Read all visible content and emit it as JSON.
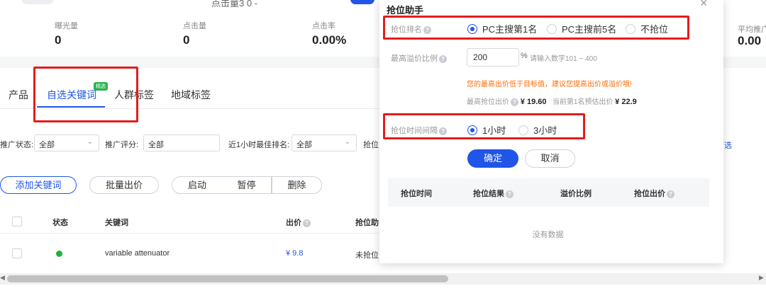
{
  "top": {
    "partial_text": "点击量3 0 -"
  },
  "stats": [
    {
      "label": "曝光量",
      "value": "0"
    },
    {
      "label": "点击量",
      "value": "0"
    },
    {
      "label": "点击率",
      "value": "0.00%"
    }
  ],
  "right_peek": {
    "label": "平均推广",
    "value": "0.00"
  },
  "tabs": [
    {
      "label": "产品"
    },
    {
      "label": "自选关键词",
      "badge": "精选"
    },
    {
      "label": "人群标签"
    },
    {
      "label": "地域标签"
    }
  ],
  "filters": {
    "status_label": "推广状态:",
    "status_value": "全部",
    "score_label": "推广评分:",
    "score_value": "全部",
    "rank_label": "近1小时最佳排名:",
    "rank_value": "全部",
    "grab_label": "抢位",
    "filter_link": "筛选"
  },
  "actions": {
    "add_keyword": "添加关键词",
    "batch_bid": "批量出价",
    "start": "启动",
    "pause": "暂停",
    "delete": "删除"
  },
  "table": {
    "headers": {
      "status": "状态",
      "keyword": "关键词",
      "bid": "出价",
      "grab": "抢位助"
    },
    "rows": [
      {
        "keyword": "variable attenuator",
        "bid": "¥ 9.8",
        "grab": "未抢位"
      }
    ]
  },
  "dialog": {
    "title": "抢位助手",
    "rank_label": "抢位排名",
    "rank_options": [
      "PC主搜第1名",
      "PC主搜前5名",
      "不抢位"
    ],
    "ratio_label": "最高溢价比例",
    "ratio_value": "200",
    "ratio_unit": "%",
    "ratio_hint": "请输入数字101 ~ 400",
    "warning": "您的最高出价低于目标值，建议您提高出价或溢价哦!",
    "max_bid_label": "最高抢位出价",
    "max_bid_value": "¥ 19.60",
    "est_label": "当前第1名预估出价",
    "est_value": "¥ 22.9",
    "interval_label": "抢位时间间隔",
    "interval_options": [
      "1小时",
      "3小时"
    ],
    "confirm": "确定",
    "cancel": "取消",
    "table_headers": [
      "抢位时间",
      "抢位结果",
      "溢价比例",
      "抢位出价"
    ],
    "empty_text": "没有数据"
  },
  "colors": {
    "accent": "#1f56e8",
    "highlight_box": "#e21d1d",
    "warning": "#ff6a00",
    "status_on": "#1fb33d"
  }
}
